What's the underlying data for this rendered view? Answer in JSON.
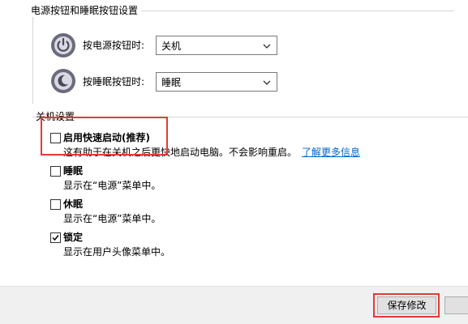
{
  "power_section": {
    "title": "电源按钮和睡眠按钮设置",
    "power_button": {
      "label": "按电源按钮时:",
      "value": "关机",
      "icon": "power-icon"
    },
    "sleep_button": {
      "label": "按睡眠按钮时:",
      "value": "睡眠",
      "icon": "sleep-icon"
    }
  },
  "shutdown_section": {
    "title": "关机设置",
    "options": [
      {
        "label": "启用快速启动(推荐)",
        "checked": false,
        "desc_prefix": "这有助于在关机之后更快地启动电脑。不会影响重启。",
        "desc_link": "了解更多信息"
      },
      {
        "label": "睡眠",
        "checked": false,
        "desc": "显示在“电源”菜单中。"
      },
      {
        "label": "休眠",
        "checked": false,
        "desc": "显示在“电源”菜单中。"
      },
      {
        "label": "锁定",
        "checked": true,
        "desc": "显示在用户头像菜单中。"
      }
    ]
  },
  "footer": {
    "save_label": "保存修改"
  },
  "colors": {
    "link": "#0066cc",
    "highlight": "#e53935",
    "footer_bg": "#f0f0f0"
  }
}
